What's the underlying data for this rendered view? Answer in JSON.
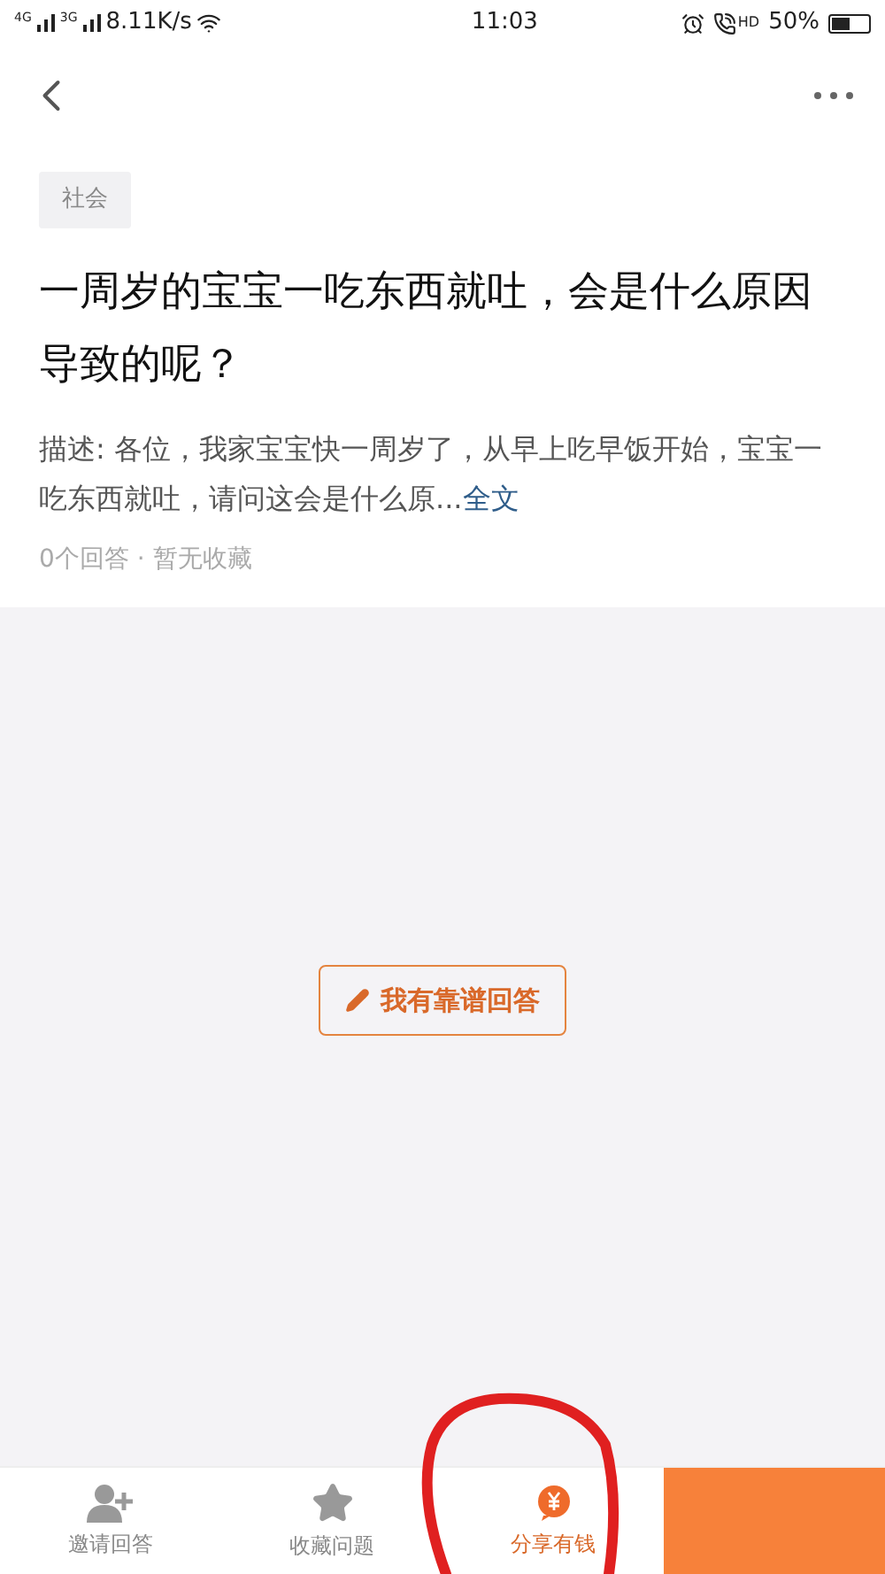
{
  "status_bar": {
    "net1": "4G",
    "net2": "3G",
    "speed": "8.11K/s",
    "time": "11:03",
    "hd": "HD",
    "battery": "50%"
  },
  "question": {
    "tag": "社会",
    "title": "一周岁的宝宝一吃东西就吐，会是什么原因导致的呢？",
    "description": "描述: 各位，我家宝宝快一周岁了，从早上吃早饭开始，宝宝一吃东西就吐，请问这会是什么原...",
    "more_link": "全文",
    "meta": "0个回答 · 暂无收藏"
  },
  "answer_button": "我有靠谱回答",
  "bottom_bar": [
    {
      "kind": "invite",
      "label": "邀请回答",
      "selected": false
    },
    {
      "kind": "favorite",
      "label": "收藏问题",
      "selected": false
    },
    {
      "kind": "share",
      "label": "分享有钱",
      "selected": true
    },
    {
      "kind": "action"
    }
  ]
}
